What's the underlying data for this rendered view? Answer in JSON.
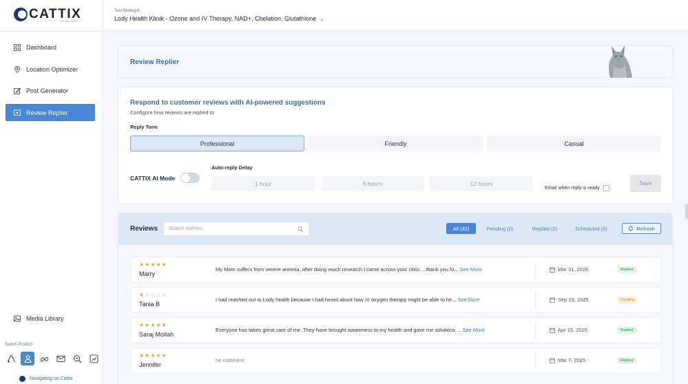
{
  "brand": {
    "name": "CATTIX",
    "tagline": "LOCAL SEO"
  },
  "header": {
    "account_label": "Test Webugol",
    "account_name": "Lody Health Klinik - Ozone and IV Therapy, NAD+, Chelation, Glutathione"
  },
  "sidebar": {
    "items": [
      {
        "label": "Dashboard",
        "icon": "grid-icon"
      },
      {
        "label": "Location Optimizer",
        "icon": "location-pin-icon"
      },
      {
        "label": "Post Generator",
        "icon": "edit-icon"
      },
      {
        "label": "Review Replier",
        "icon": "review-icon",
        "active": true
      }
    ],
    "media_library": "Media Library",
    "switch_product_label": "Switch Product",
    "navigating_label": "Navigating on Cattix"
  },
  "hero": {
    "title": "Review Replier"
  },
  "settings": {
    "title": "Respond to customer reviews with AI-powered suggestions",
    "subtitle": "Configure how reviews are replied to",
    "tone_label": "Reply Tone",
    "tones": [
      "Professional",
      "Friendly",
      "Casual"
    ],
    "selected_tone": "Professional",
    "ai_mode_label": "CATTIX AI Mode",
    "ai_mode_on": false,
    "delay_label": "Auto-reply Delay",
    "delays": [
      "1 hour",
      "6 hours",
      "12 hours"
    ],
    "email_label": "Email when reply is ready",
    "save_label": "Save"
  },
  "reviews": {
    "title": "Reviews",
    "search_placeholder": "Search reviews...",
    "tabs": [
      "All (32)",
      "Pending (0)",
      "Replied (0)",
      "Scheduled (0)"
    ],
    "active_tab": "All (32)",
    "refresh_label": "Refresh",
    "see_more": "See More",
    "rows": [
      {
        "stars": 5,
        "name": "Marry",
        "text": "My Mom suffers from severe anemia, after doing much research I came across your clinic....thank you fo...",
        "date": "Mar 31, 2026",
        "status": "Replied"
      },
      {
        "stars": 1,
        "name": "Tania B",
        "text": "I had reached out to Lody health because I had heard about how IV oxygen therapy might be able to he...",
        "date": "Sep 19, 2025",
        "status": "Pending"
      },
      {
        "stars": 5,
        "name": "Saraj Mollah",
        "text": "Everyone has taken great care of me. They have brought awareness to my health and gave me solutions ...",
        "date": "Apr 15, 2025",
        "status": "Replied"
      },
      {
        "stars": 5,
        "name": "Jennifer",
        "text": "no comment",
        "date": "Mar 7, 2025",
        "status": "Replied"
      }
    ]
  },
  "colors": {
    "accent": "#4a86d6",
    "title_blue": "#3a6fa8",
    "star": "#f0a51f",
    "replied_bg": "#dff3e4",
    "pending_bg": "#fdeed6"
  }
}
